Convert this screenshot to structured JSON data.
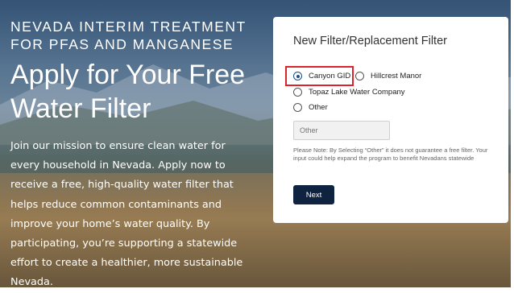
{
  "hero": {
    "eyebrow": "NEVADA INTERIM TREATMENT FOR PFAS AND MANGANESE",
    "headline": "Apply for Your Free Water Filter",
    "body": "Join our mission to ensure clean water for every household in Nevada. Apply now to receive a free, high-quality water filter that helps reduce common contaminants and improve your home’s water quality. By participating, you’re supporting a statewide effort to create a healthier, more sustainable Nevada."
  },
  "form": {
    "title": "New Filter/Replacement Filter",
    "options": [
      {
        "label": "Canyon GID",
        "selected": true
      },
      {
        "label": "Hillcrest Manor",
        "selected": false
      },
      {
        "label": "Topaz Lake Water Company",
        "selected": false
      },
      {
        "label": "Other",
        "selected": false
      }
    ],
    "other_placeholder": "Other",
    "note": "Please Note: By Selecting “Other” it does not guarantee a free filter. Your input could help expand the program to benefit Nevadans statewide",
    "next_label": "Next"
  },
  "colors": {
    "highlight": "#d9232d",
    "button_bg": "#0f2340",
    "radio_selected": "#1b4f8a"
  }
}
